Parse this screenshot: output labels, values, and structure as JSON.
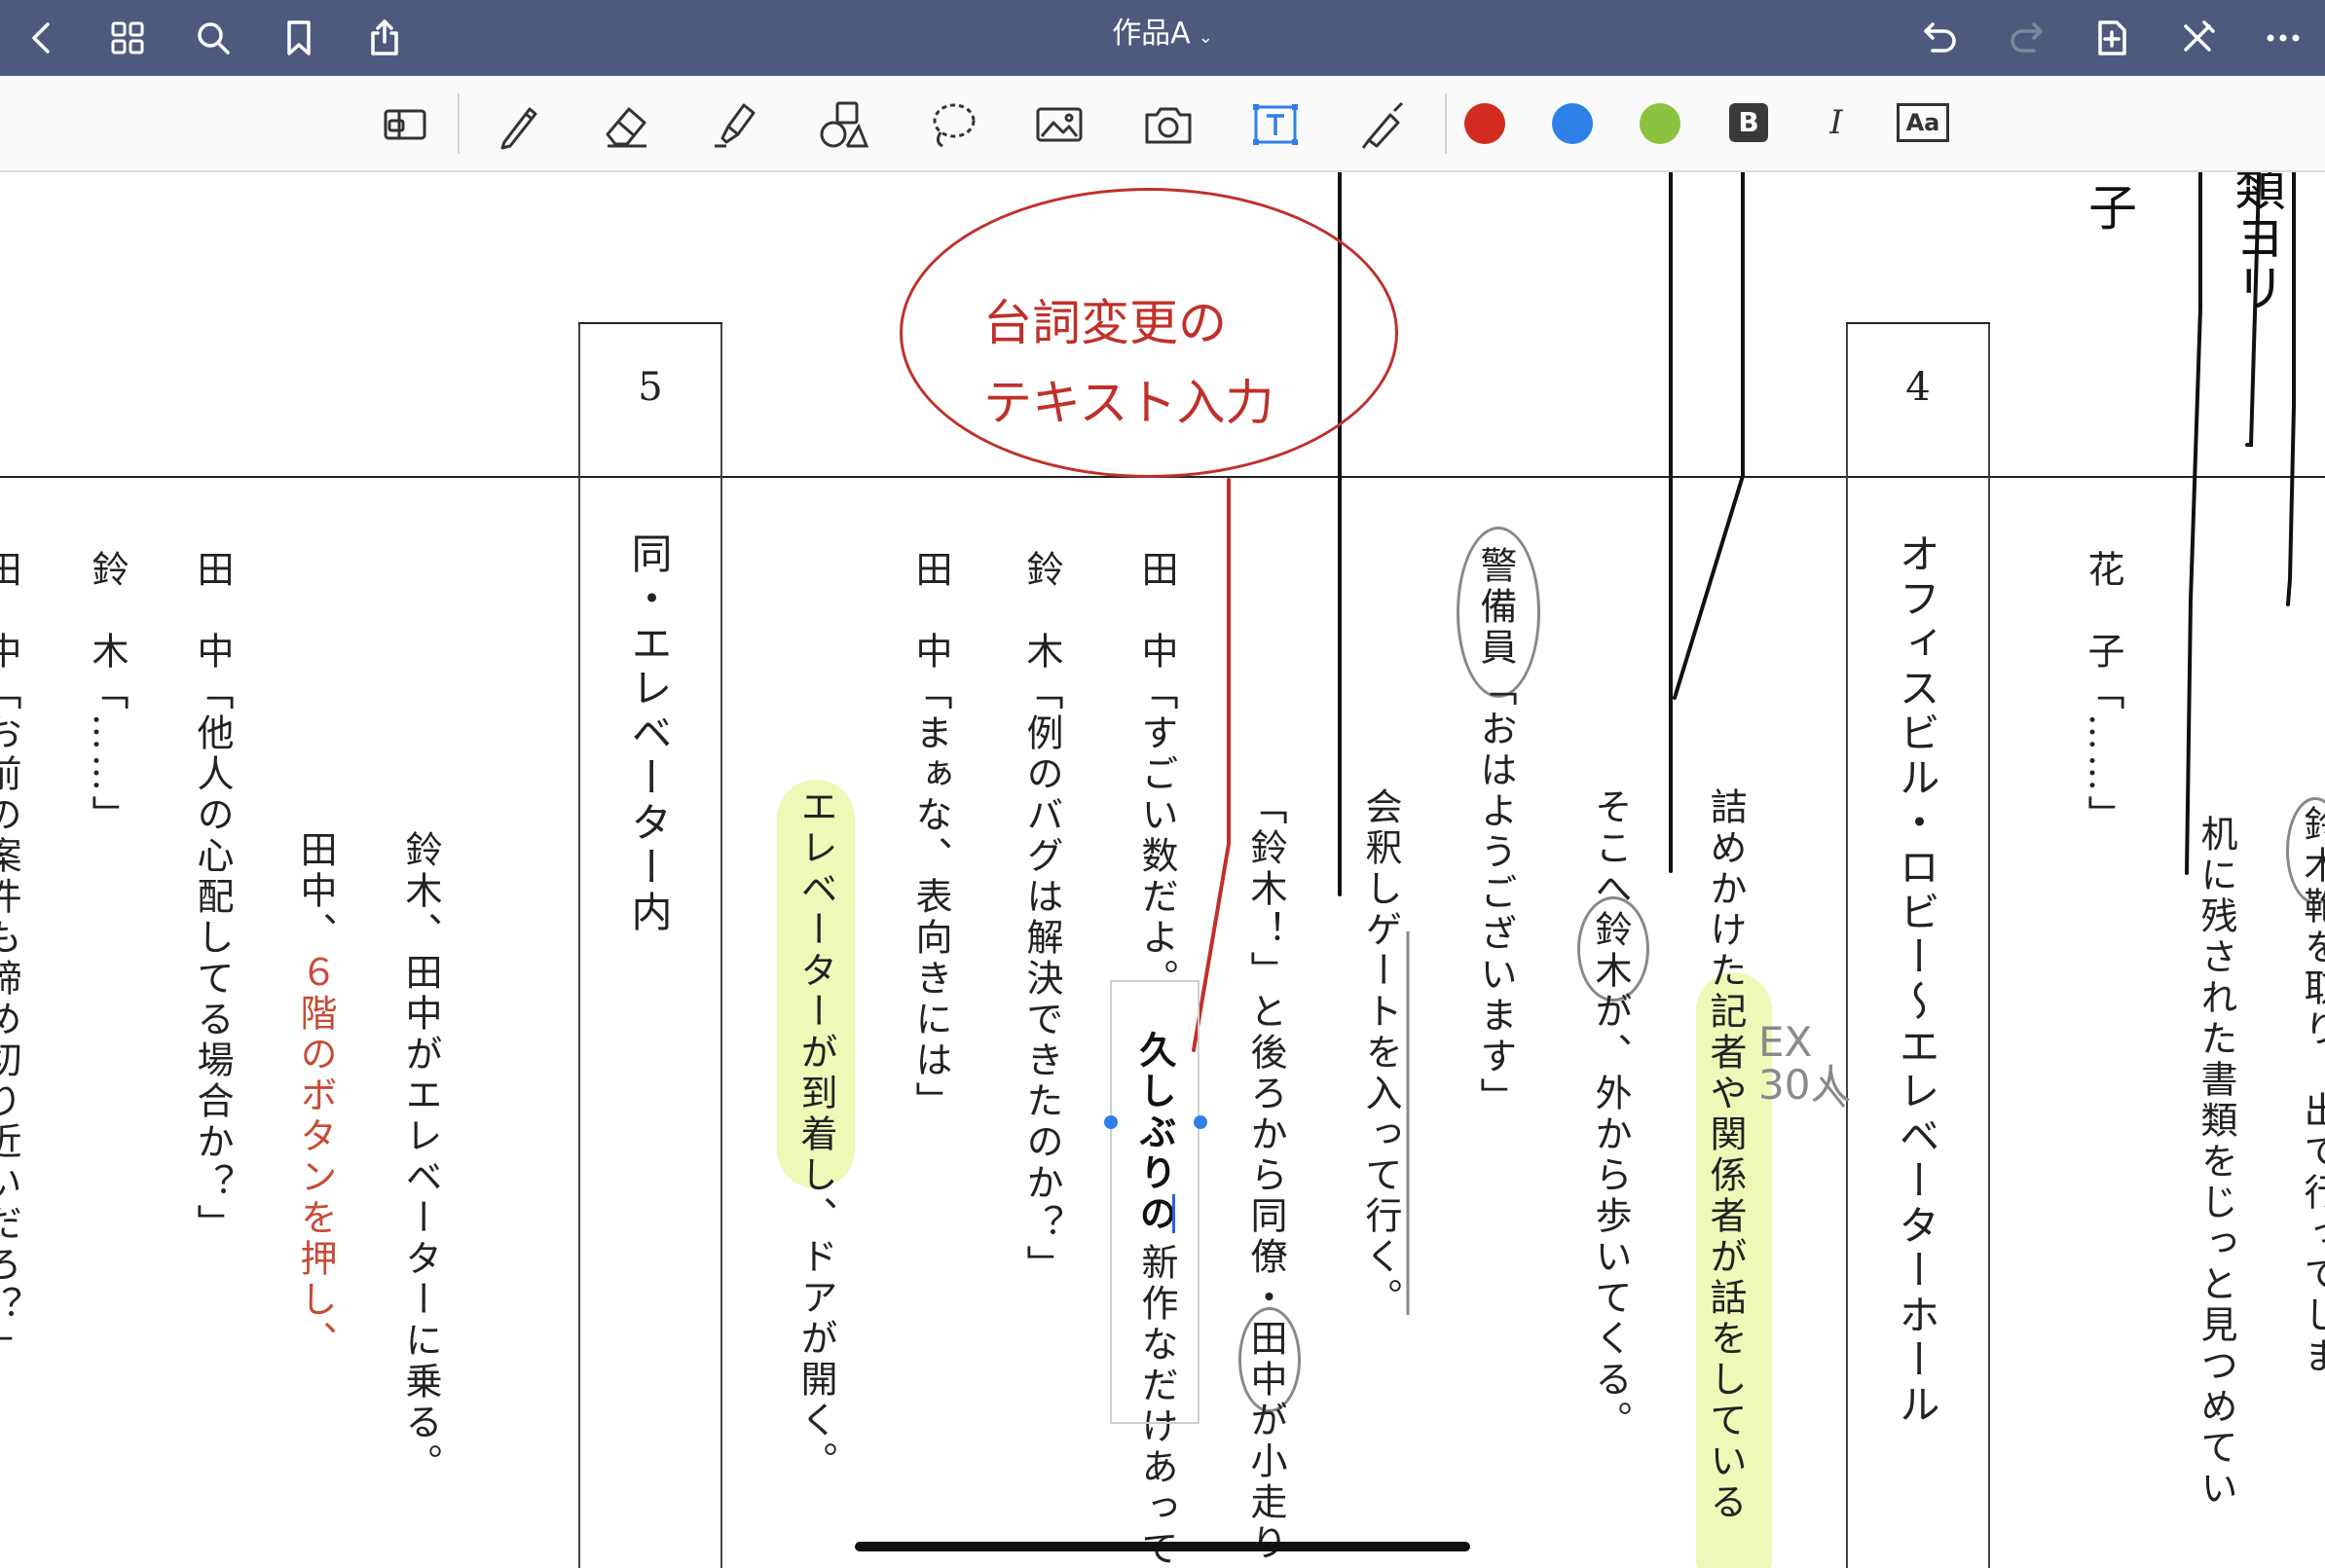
{
  "app": {
    "title": "作品A",
    "title_chevron": "⌄",
    "accent": "#4e5a7d",
    "icons": [
      "back-icon",
      "grid-icon",
      "search-icon",
      "bookmark-icon",
      "share-icon",
      "undo-icon",
      "redo-icon",
      "add-page-icon",
      "close-pen-icon",
      "more-icon"
    ]
  },
  "toolbar": {
    "tools": [
      "layout-icon",
      "pen-icon",
      "eraser-icon",
      "highlighter-icon",
      "shapes-icon",
      "lasso-icon",
      "image-icon",
      "camera-icon",
      "text-tool-icon",
      "laser-pointer-icon"
    ],
    "colors": [
      "#d42b21",
      "#2f7fe8",
      "#8ac33d"
    ],
    "bold_label": "B",
    "italic_label": "I",
    "text_style_label": "Aa"
  },
  "document": {
    "scene5": {
      "number": "5",
      "heading": "同・エレベーター内"
    },
    "scene4": {
      "number": "4",
      "heading": "オフィスビル・ロビー～エレベーターホール"
    },
    "callout": {
      "line1": "台詞変更の",
      "line2": "テキスト入力"
    },
    "textbox_value": "久しぶりの",
    "annotation_ex": "EX",
    "annotation_count": "30人",
    "handwriting": {
      "ko": "子",
      "rui": "類ヨリ"
    },
    "columns": {
      "c1": "机に残された書類をじっと見つめてい",
      "c2": "花　子「……」",
      "c3_a": "詰めかけ",
      "c3_b": "た記者や関係者が話をしている",
      "c4_a": "そこへ",
      "c4_b": "鈴木",
      "c4_c": "が、外から歩いてくる。",
      "c5_a": "警備員",
      "c5_b": "「おはようございます」",
      "c6": "会釈しゲートを入って行く。",
      "c7_a": "「鈴木！」と後ろから同僚・",
      "c7_b": "田中",
      "c7_c": "が小走り",
      "c8_a": "田　中「すごい数だよ。",
      "c8_b": "新作なだけあって",
      "c9": "鈴　木「例のバグは解決できたのか？」",
      "c10": "田　中「まぁな、表向きには」",
      "c11_a": "エレベーターが到着",
      "c11_b": "し、ドアが開く。",
      "c12": "鈴木、田中がエレベーターに乗る。",
      "c13_a": "田中、",
      "c13_b": "６階のボタンを押し、",
      "c14": "田　中「他人の心配してる場合か？」",
      "c15": "鈴　木「……」",
      "c16": "田　中「お前の案件も締め切り近いだろ？」",
      "c17_a": "鈴木",
      "c17_b": "鞄を取り、出て行ってしま"
    }
  }
}
